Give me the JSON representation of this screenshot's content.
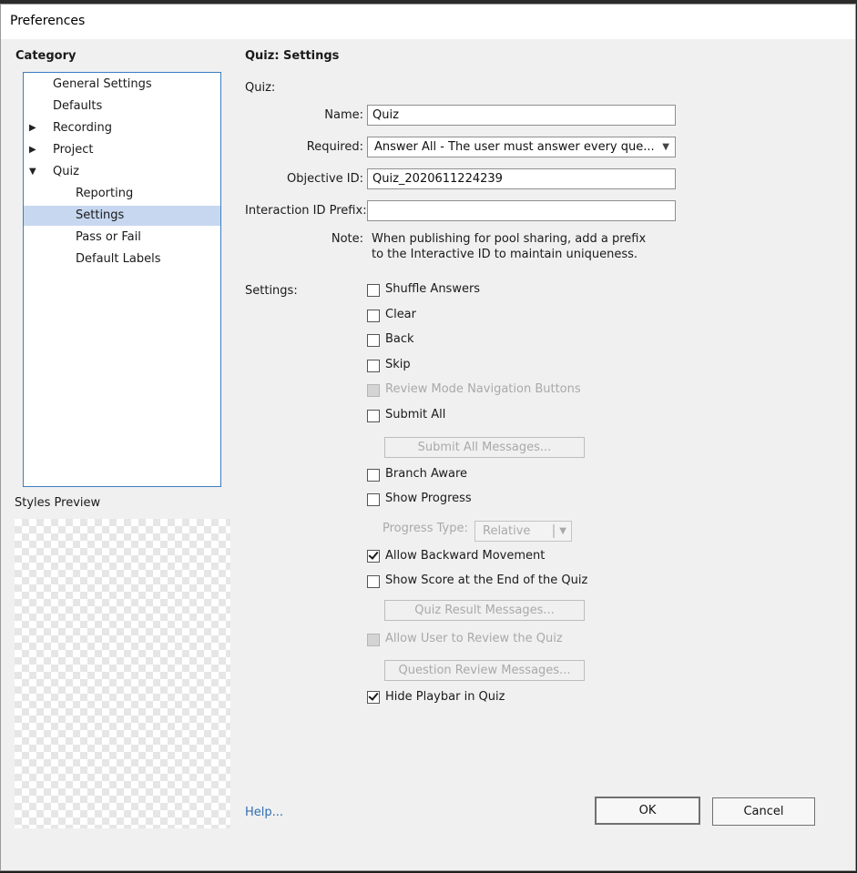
{
  "window": {
    "title": "Preferences"
  },
  "category": {
    "heading": "Category",
    "items": [
      {
        "label": "General Settings"
      },
      {
        "label": "Defaults"
      },
      {
        "label": "Recording"
      },
      {
        "label": "Project"
      },
      {
        "label": "Quiz"
      },
      {
        "label": "Reporting"
      },
      {
        "label": "Settings",
        "selected": true
      },
      {
        "label": "Pass or Fail"
      },
      {
        "label": "Default Labels"
      }
    ],
    "expanded_arrow": "▼",
    "collapsed_arrow": "▶"
  },
  "styles_preview": {
    "label": "Styles Preview"
  },
  "panel": {
    "title": "Quiz: Settings",
    "section_quiz": "Quiz:",
    "name_label": "Name:",
    "name_value": "Quiz",
    "required_label": "Required:",
    "required_value": "Answer All - The user must answer every que...",
    "objective_label": "Objective ID:",
    "objective_value": "Quiz_2020611224239",
    "prefix_label": "Interaction ID Prefix:",
    "prefix_value": "",
    "note_label": "Note:",
    "note_line1": "When publishing for pool sharing, add a prefix",
    "note_line2": "to the Interactive ID to maintain uniqueness.",
    "settings_label": "Settings:"
  },
  "settings": {
    "shuffle_answers": {
      "label": "Shuffle Answers",
      "checked": false,
      "enabled": true
    },
    "clear": {
      "label": "Clear",
      "checked": false,
      "enabled": true
    },
    "back": {
      "label": "Back",
      "checked": false,
      "enabled": true
    },
    "skip": {
      "label": "Skip",
      "checked": false,
      "enabled": true
    },
    "review_mode_nav": {
      "label": "Review Mode Navigation Buttons",
      "checked": false,
      "enabled": false
    },
    "submit_all": {
      "label": "Submit All",
      "checked": false,
      "enabled": true
    },
    "submit_all_messages": "Submit All Messages...",
    "branch_aware": {
      "label": "Branch Aware",
      "checked": false,
      "enabled": true
    },
    "show_progress": {
      "label": "Show Progress",
      "checked": false,
      "enabled": true
    },
    "progress_type_label": "Progress Type:",
    "progress_type_value": "Relative",
    "allow_backward": {
      "label": "Allow Backward Movement",
      "checked": true,
      "enabled": true
    },
    "show_score": {
      "label": "Show Score at the End of the Quiz",
      "checked": false,
      "enabled": true
    },
    "quiz_result_messages": "Quiz Result Messages...",
    "allow_review": {
      "label": "Allow User to Review the Quiz",
      "checked": false,
      "enabled": false
    },
    "question_review_messages": "Question Review Messages...",
    "hide_playbar": {
      "label": "Hide Playbar in Quiz",
      "checked": true,
      "enabled": true
    }
  },
  "footer": {
    "help": "Help...",
    "ok": "OK",
    "cancel": "Cancel"
  }
}
